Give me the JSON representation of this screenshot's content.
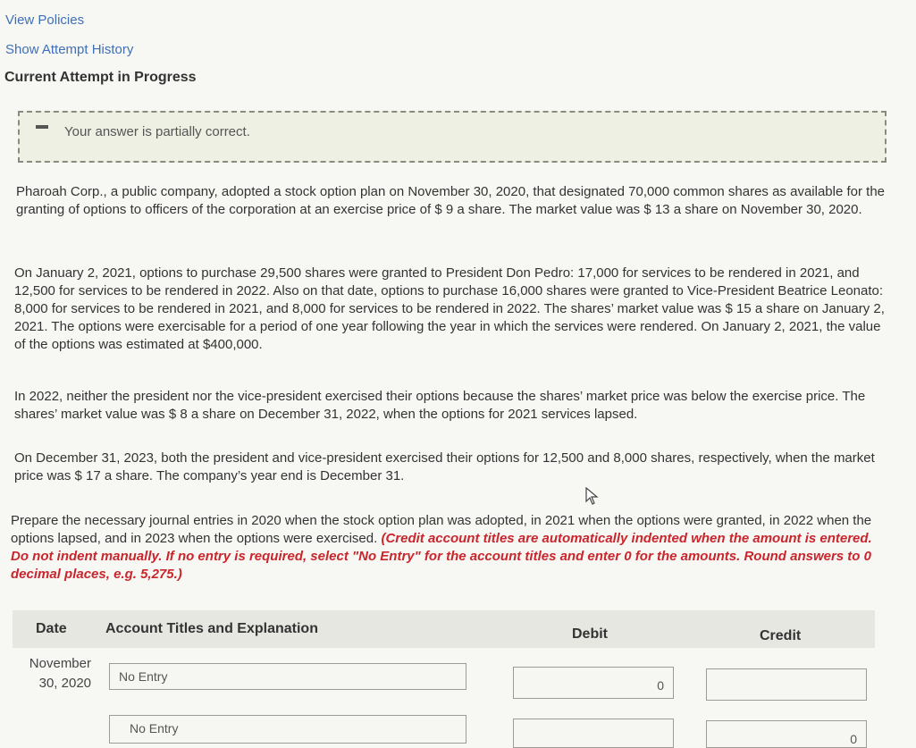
{
  "links": {
    "view_policies": "View Policies",
    "show_attempt_history": "Show Attempt History"
  },
  "attempt_title": "Current Attempt in Progress",
  "feedback": {
    "text": "Your answer is partially correct."
  },
  "problem": {
    "p1": "Pharoah Corp., a public company, adopted a stock option plan on November 30, 2020, that designated 70,000 common shares as available for the granting of options to officers of the corporation at an exercise price of $ 9 a share. The market value was $ 13 a share on November 30, 2020.",
    "p2": "On January 2, 2021, options to purchase 29,500 shares were granted to President Don Pedro: 17,000 for services to be rendered in 2021, and 12,500 for services to be rendered in 2022. Also on that date, options to purchase 16,000 shares were granted to Vice-President Beatrice Leonato: 8,000 for services to be rendered in 2021, and 8,000 for services to be rendered in 2022. The shares’ market value was $ 15 a share on January 2, 2021. The options were exercisable for a period of one year following the year in which the services were rendered. On January 2, 2021, the value of the options was estimated at $400,000.",
    "p3": "In 2022, neither the president nor the vice-president exercised their options because the shares’ market price was below the exercise price. The shares’ market value was $ 8 a share on December 31, 2022, when the options for 2021 services lapsed.",
    "p4": "On December 31, 2023, both the president and vice-president exercised their options for 12,500 and 8,000 shares, respectively, when the market price was $ 17 a share. The company’s year end is December 31.",
    "p5_plain": "Prepare the necessary journal entries in 2020 when the stock option plan was adopted, in 2021 when the options were granted, in 2022 when the options lapsed, and in 2023 when the options were exercised. ",
    "p5_red": "(Credit account titles are automatically indented when the amount is entered. Do not indent manually. If no entry is required, select \"No Entry\" for the account titles and enter 0 for the amounts. Round answers to 0 decimal places, e.g. 5,275.)"
  },
  "table": {
    "headers": {
      "date": "Date",
      "account": "Account Titles and Explanation",
      "debit": "Debit",
      "credit": "Credit"
    },
    "rows": [
      {
        "date_line1": "November",
        "date_line2": "30, 2020",
        "account": "No Entry",
        "debit": "0",
        "credit": ""
      },
      {
        "account": "No Entry",
        "debit": "",
        "credit": "0"
      }
    ]
  },
  "colors": {
    "link": "#3f6fb5",
    "instruction_red": "#c9252c",
    "feedback_bg": "#eef0e4",
    "table_header_bg": "#e6e7e1"
  },
  "icons": {
    "cursor": "mouse-pointer-icon",
    "partial": "minus-icon"
  }
}
